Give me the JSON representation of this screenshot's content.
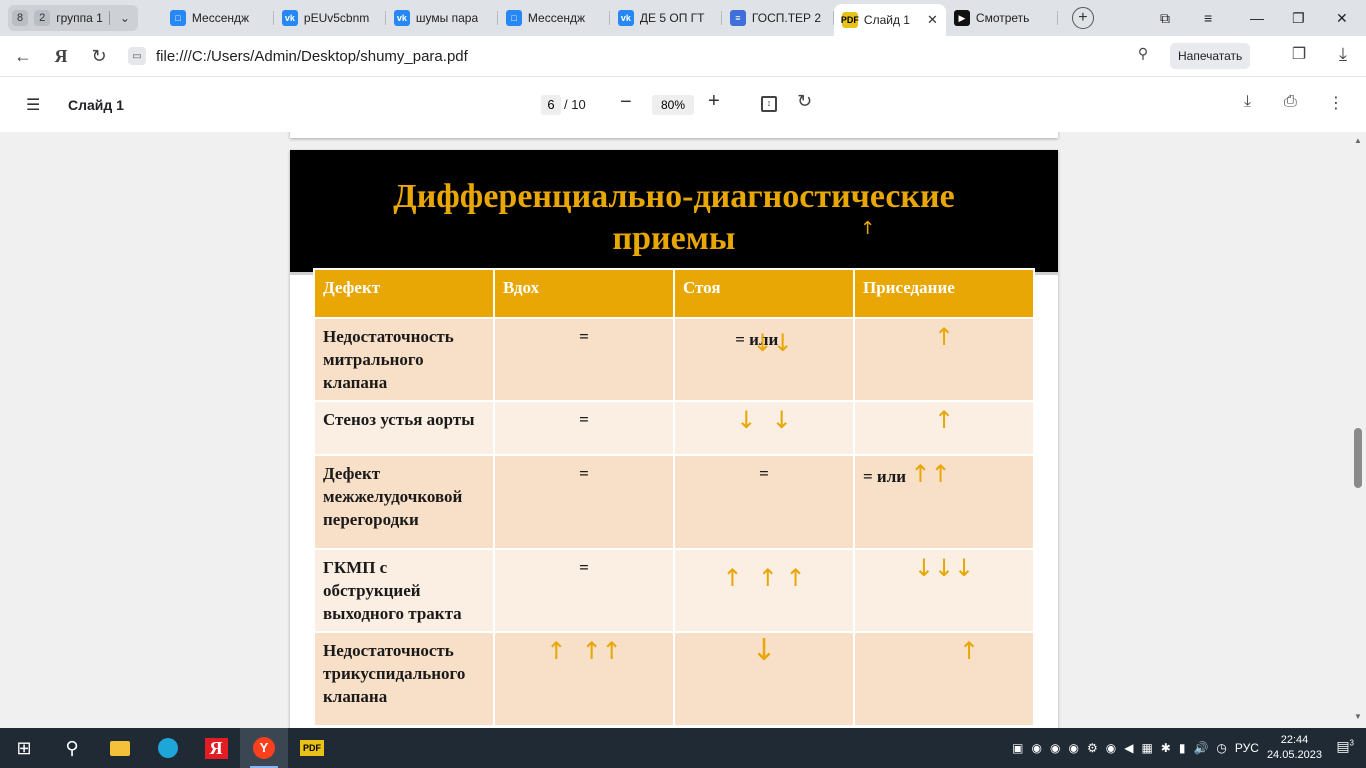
{
  "browser": {
    "tab_group": {
      "count": "8",
      "badge2": "2",
      "label": "группа 1"
    },
    "tabs": [
      {
        "label": "Мессендж",
        "icon": "messenger-icon",
        "color": "#2787f5"
      },
      {
        "label": "pEUv5cbnm",
        "icon": "vk-icon",
        "color": "#2787f5"
      },
      {
        "label": "шумы пара",
        "icon": "vk-icon",
        "color": "#2787f5"
      },
      {
        "label": "Мессендж",
        "icon": "messenger-icon",
        "color": "#2787f5"
      },
      {
        "label": "ДЕ 5 ОП ГТ",
        "icon": "vk-icon",
        "color": "#2787f5"
      },
      {
        "label": "ГОСП.ТЕР 2",
        "icon": "docs-icon",
        "color": "#3f6fd8"
      },
      {
        "label": "Слайд 1",
        "icon": "pdf-icon",
        "color": "#e8c21b",
        "active": true
      },
      {
        "label": "Смотреть",
        "icon": "play-icon",
        "color": "#111111"
      }
    ],
    "url": "file:///C:/Users/Admin/Desktop/shumy_para.pdf",
    "print_button": "Напечатать"
  },
  "pdf_toolbar": {
    "title": "Слайд 1",
    "page_current": "6",
    "page_total": "/ 10",
    "zoom": "80%"
  },
  "slide": {
    "title_line1": "Дифференциально-диагностические",
    "title_line2": "приемы",
    "title_arrow": "↑",
    "headers": [
      "Дефект",
      "Вдох",
      "Стоя",
      "Приседание"
    ],
    "rows": [
      {
        "defect": "Недостаточность митрального клапана",
        "vdoh": "=",
        "stoya": "= или",
        "stoya_arrows": "↓↓",
        "prisedanie": "",
        "prisedanie_arrows": "↑"
      },
      {
        "defect": "Стеноз устья аорты",
        "vdoh": "=",
        "stoya": "",
        "stoya_arrows": "↓  ↓",
        "prisedanie": "",
        "prisedanie_arrows": "↑"
      },
      {
        "defect": "Дефект межжелудочковой перегородки",
        "vdoh": "=",
        "stoya": "=",
        "stoya_arrows": "",
        "prisedanie": "= или",
        "prisedanie_arrows": "↑↑"
      },
      {
        "defect": "ГКМП с обструкцией выходного тракта",
        "vdoh": "=",
        "stoya": "",
        "stoya_arrows": "↑  ↑ ↑",
        "prisedanie": "",
        "prisedanie_arrows": "↓↓↓"
      },
      {
        "defect": "Недостаточность трикуспидального клапана",
        "vdoh": "",
        "vdoh_arrows": "↑  ↑↑",
        "stoya": "",
        "stoya_arrows": "↓",
        "prisedanie": "",
        "prisedanie_arrows": "↑"
      }
    ]
  },
  "taskbar": {
    "language": "РУС",
    "time": "22:44",
    "date": "24.05.2023",
    "notifications": "3"
  }
}
